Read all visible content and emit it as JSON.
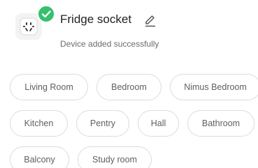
{
  "device": {
    "name": "Fridge socket",
    "status": "Device added successfully",
    "icon": "smart-plug-icon",
    "badge_icon": "check-icon",
    "edit_icon": "pencil-icon",
    "badge_color": "#35c06d"
  },
  "rooms": [
    {
      "label": "Living Room"
    },
    {
      "label": "Bedroom"
    },
    {
      "label": "Nimus Bedroom"
    },
    {
      "label": "Kitchen"
    },
    {
      "label": "Pentry"
    },
    {
      "label": "Hall"
    },
    {
      "label": "Bathroom"
    },
    {
      "label": "Balcony"
    },
    {
      "label": "Study room"
    }
  ]
}
